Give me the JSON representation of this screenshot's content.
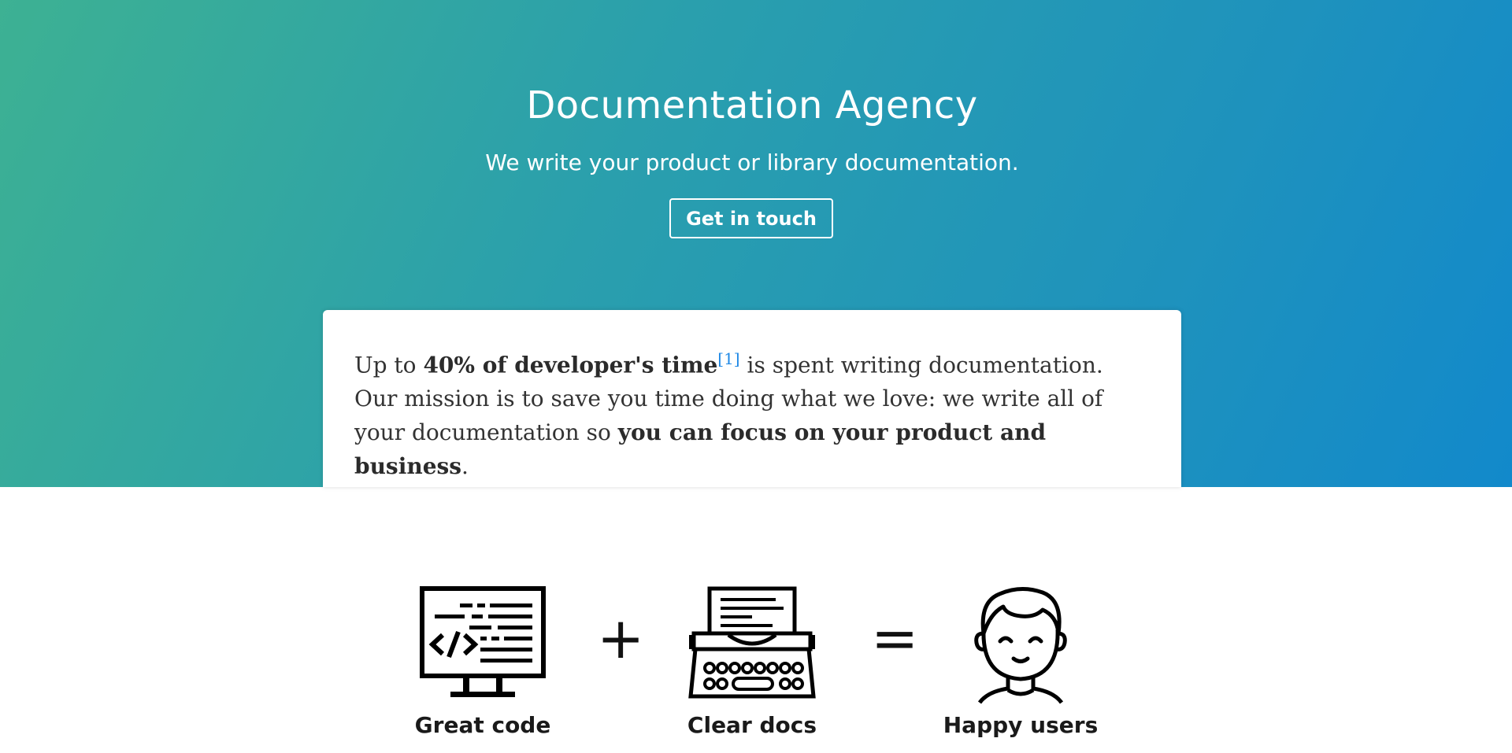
{
  "hero": {
    "title": "Documentation Agency",
    "subtitle": "We write your product or library documentation.",
    "cta_label": "Get in touch",
    "gradient_start": "#3db193",
    "gradient_end": "#1289cb"
  },
  "mission": {
    "part1": "Up to ",
    "stat": "40% of developer's time",
    "footnote": "[1]",
    "part2": " is spent writing documentation. Our mission is to save you time doing what we love: we write all of your documentation so ",
    "emphasis": "you can focus on your product and business",
    "part3": "."
  },
  "equation": {
    "items": [
      {
        "label": "Great code",
        "icon": "code-monitor-icon"
      },
      {
        "label": "Clear docs",
        "icon": "typewriter-icon"
      },
      {
        "label": "Happy users",
        "icon": "happy-user-icon"
      }
    ],
    "plus": "+",
    "equals": "="
  }
}
